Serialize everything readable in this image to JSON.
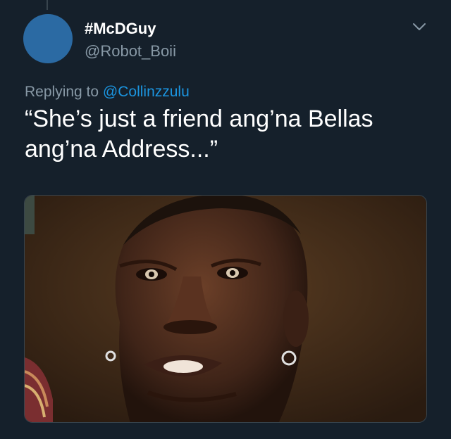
{
  "tweet": {
    "display_name": "#McDGuy",
    "handle": "@Robot_Boii",
    "replying_prefix": "Replying to",
    "replying_to": "@Collinzzulu",
    "text": "“She’s just a friend ang’na Bellas ang’na Address...”"
  },
  "media": {
    "alt": "photo of a man with hoop earrings"
  },
  "icons": {
    "more": "chevron-down-icon"
  },
  "colors": {
    "background": "#15202b",
    "secondary_text": "#8899a6",
    "link": "#1b95e0",
    "avatar": "#2b6aa3"
  }
}
